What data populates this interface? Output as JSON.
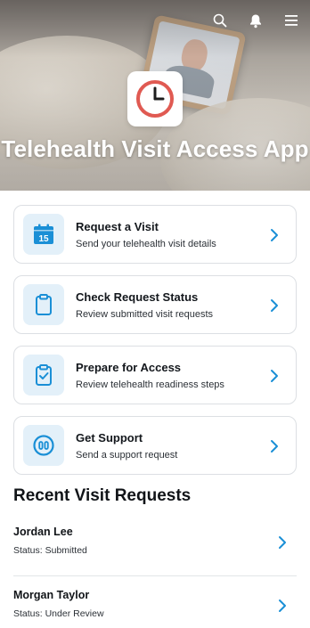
{
  "header": {
    "app_title": "Telehealth Visit Access App",
    "icons": [
      "search-icon",
      "notification-bell-icon",
      "menu-icon"
    ],
    "logo_icon": "clock-icon"
  },
  "colors": {
    "accent": "#1a8fd6",
    "icon_bg": "#e3f0f9",
    "logo_ring": "#e05a52"
  },
  "actions": [
    {
      "title": "Request a Visit",
      "subtitle": "Send your telehealth visit details",
      "icon": "calendar-icon",
      "icon_text": "15"
    },
    {
      "title": "Check Request Status",
      "subtitle": "Review submitted visit requests",
      "icon": "clipboard-icon"
    },
    {
      "title": "Prepare for Access",
      "subtitle": "Review telehealth readiness steps",
      "icon": "clipboard-check-icon"
    },
    {
      "title": "Get Support",
      "subtitle": "Send a support request",
      "icon": "support-icon"
    }
  ],
  "recent": {
    "title": "Recent Visit Requests",
    "items": [
      {
        "name": "Jordan Lee",
        "status": "Status: Submitted"
      },
      {
        "name": "Morgan Taylor",
        "status": "Status: Under Review"
      }
    ]
  }
}
